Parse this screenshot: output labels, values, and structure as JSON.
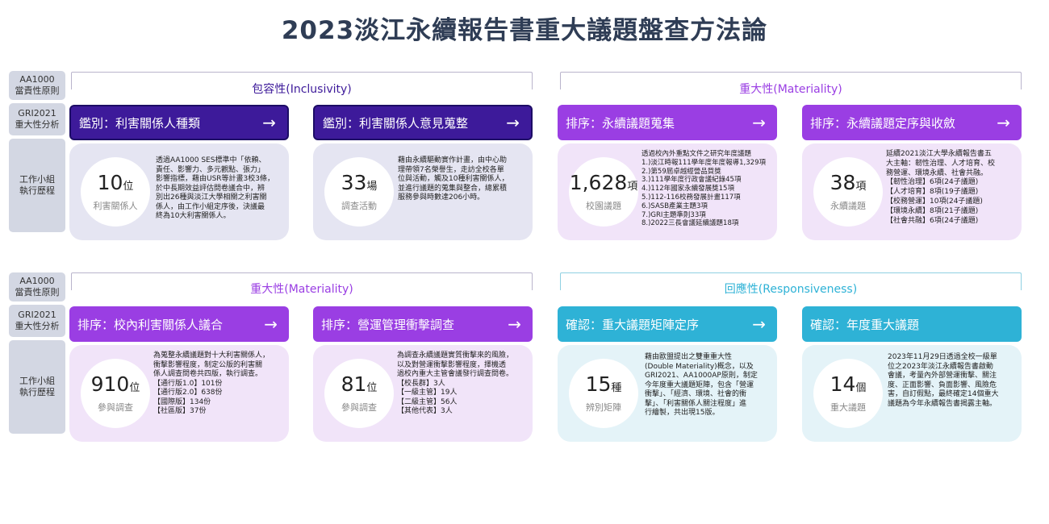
{
  "title": "2023淡江永續報告書重大議題盤查方法論",
  "row_labels": {
    "principle": "AA1000\n當責性原則",
    "gri": "GRI2021\n重大性分析",
    "work": "工作小組\n執行歷程"
  },
  "principles": {
    "inclusivity": "包容性(Inclusivity)",
    "materiality_top": "重大性(Materiality)",
    "materiality_bottom": "重大性(Materiality)",
    "responsiveness": "回應性(Responsiveness)"
  },
  "colors": {
    "navy": "#3d1a9a",
    "purple": "#9a3ee3",
    "cyan": "#2eb2d6",
    "title": "#2f3d55"
  },
  "steps": [
    {
      "header": "鑑別：利害關係人種類",
      "arrow": "→",
      "number": "10",
      "unit": "位",
      "caption": "利害關係人",
      "description": "透過AA1000 SES標準中「依賴、\n責任、影響力、多元觀點、張力」\n影響指標，藉由USR等計畫3校3條，\n於中長期效益評估問卷議合中，辨\n別出26種與淡江大學相關之利害關\n係人，由工作小組定序後，決議最\n終為10大利害關係人。"
    },
    {
      "header": "鑑別：利害關係人意見蒐整",
      "arrow": "→",
      "number": "33",
      "unit": "場",
      "caption": "調查活動",
      "description": "藉由永續驅動實作計畫，由中心助\n理帶領7名榮譽生，走訪全校各單\n位與活動，觸及10種利害關係人，\n並進行議題的蒐集與整合，總累積\n服務參與時數達206小時。"
    },
    {
      "header": "排序：永續議題蒐集",
      "arrow": "→",
      "number": "1,628",
      "unit": "項",
      "caption": "校園議題",
      "description": "透過校內外重點文件之研究年度議題\n1.)淡江時報111學年度年度報導1,329項\n2.)第59屆卓越經營品質獎\n3.)111學年度行政會議紀錄45項\n4.)112年國家永續發展獎15項\n5.)112-116校務發展計畫117項\n6.)SASB產業主題3項\n7.)GRI主題準則33項\n8.)2022三長會議延續議題18項"
    },
    {
      "header": "排序：永續議題定序與收斂",
      "arrow": "→",
      "number": "38",
      "unit": "項",
      "caption": "永續議題",
      "description": "延續2021淡江大學永續報告書五\n大主軸：韌性治理、人才培育、校\n務營運、環境永續、社會共融。\n【韌性治理】6項(24子議題)\n【人才培育】8項(19子議題)\n【校務營運】10項(24子議題)\n【環境永續】8項(21子議題)\n【社會共融】6項(24子議題)"
    },
    {
      "header": "排序：校內利害關係人議合",
      "arrow": "→",
      "number": "910",
      "unit": "位",
      "caption": "參與調查",
      "description": "為蒐整永續議題對十大利害關係人，\n衝擊影響程度，制定公版的利害關\n係人調查問卷共四版，執行調查。\n【通行版1.0】101份\n【通行版2.0】638份\n【國際版】134份\n【社區版】37份"
    },
    {
      "header": "排序：營運管理衝擊調查",
      "arrow": "→",
      "number": "81",
      "unit": "位",
      "caption": "參與調查",
      "description": "為調查永續議題實質衝擊來的風險，\n以及對營運衝擊影響程度，擇機透\n過校內重大主管會議發行調查問卷。\n【校長群】3人\n【一級主管】19人\n【二級主管】56人\n【其他代表】3人"
    },
    {
      "header": "確認：重大議題矩陣定序",
      "arrow": "→",
      "number": "15",
      "unit": "種",
      "caption": "辨別矩陣",
      "description": "藉由歐盟提出之雙重重大性\n(Double Materiality)概念，以及\nGRI2021、AA1000AP原則，制定\n今年度重大議題矩陣，包含「營運\n衝擊」、「經濟、環境、社會的衝\n擊」、「利害關係人關注程度」進\n行繪製，共出現15版。"
    },
    {
      "header": "確認：年度重大議題",
      "arrow": "",
      "number": "14",
      "unit": "個",
      "caption": "重大議題",
      "description": "2023年11月29日透過全校一級單\n位之2023年淡江永續報告書啟動\n會議，考量內外部營運衝擊、關注\n度、正面影響、負面影響、風險危\n害，自訂假點，最終確定14個重大\n議題為今年永續報告書揭露主軸。"
    }
  ]
}
